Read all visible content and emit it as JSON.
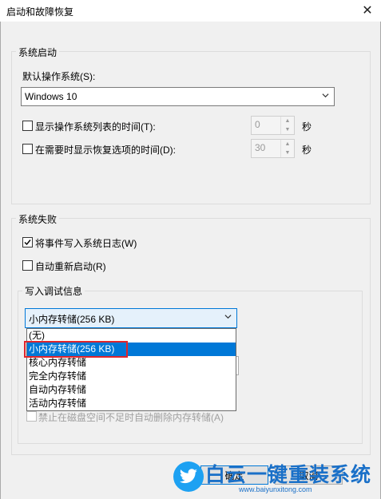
{
  "window": {
    "title": "启动和故障恢复",
    "close_glyph": "✕"
  },
  "startup": {
    "group_label": "系统启动",
    "default_os_label": "默认操作系统(S):",
    "default_os_value": "Windows 10",
    "show_list": {
      "label": "显示操作系统列表的时间(T):",
      "checked": false,
      "value": "0",
      "unit": "秒"
    },
    "show_recovery": {
      "label": "在需要时显示恢复选项的时间(D):",
      "checked": false,
      "value": "30",
      "unit": "秒"
    }
  },
  "failure": {
    "group_label": "系统失败",
    "write_event": {
      "label": "将事件写入系统日志(W)",
      "checked": true
    },
    "auto_restart": {
      "label": "自动重新启动(R)",
      "checked": false
    },
    "debug": {
      "group_label": "写入调试信息",
      "selected": "小内存转储(256 KB)",
      "options": [
        "(无)",
        "小内存转储(256 KB)",
        "核心内存转储",
        "完全内存转储",
        "自动内存转储",
        "活动内存转储"
      ],
      "disable_auto_delete_label": "禁止在磁盘空间不足时自动删除内存转储(A)"
    }
  },
  "buttons": {
    "ok": "确定",
    "cancel": "取消"
  },
  "watermark": {
    "text": "白云一键重装系统",
    "url": "www.baiyunxitong.com"
  }
}
